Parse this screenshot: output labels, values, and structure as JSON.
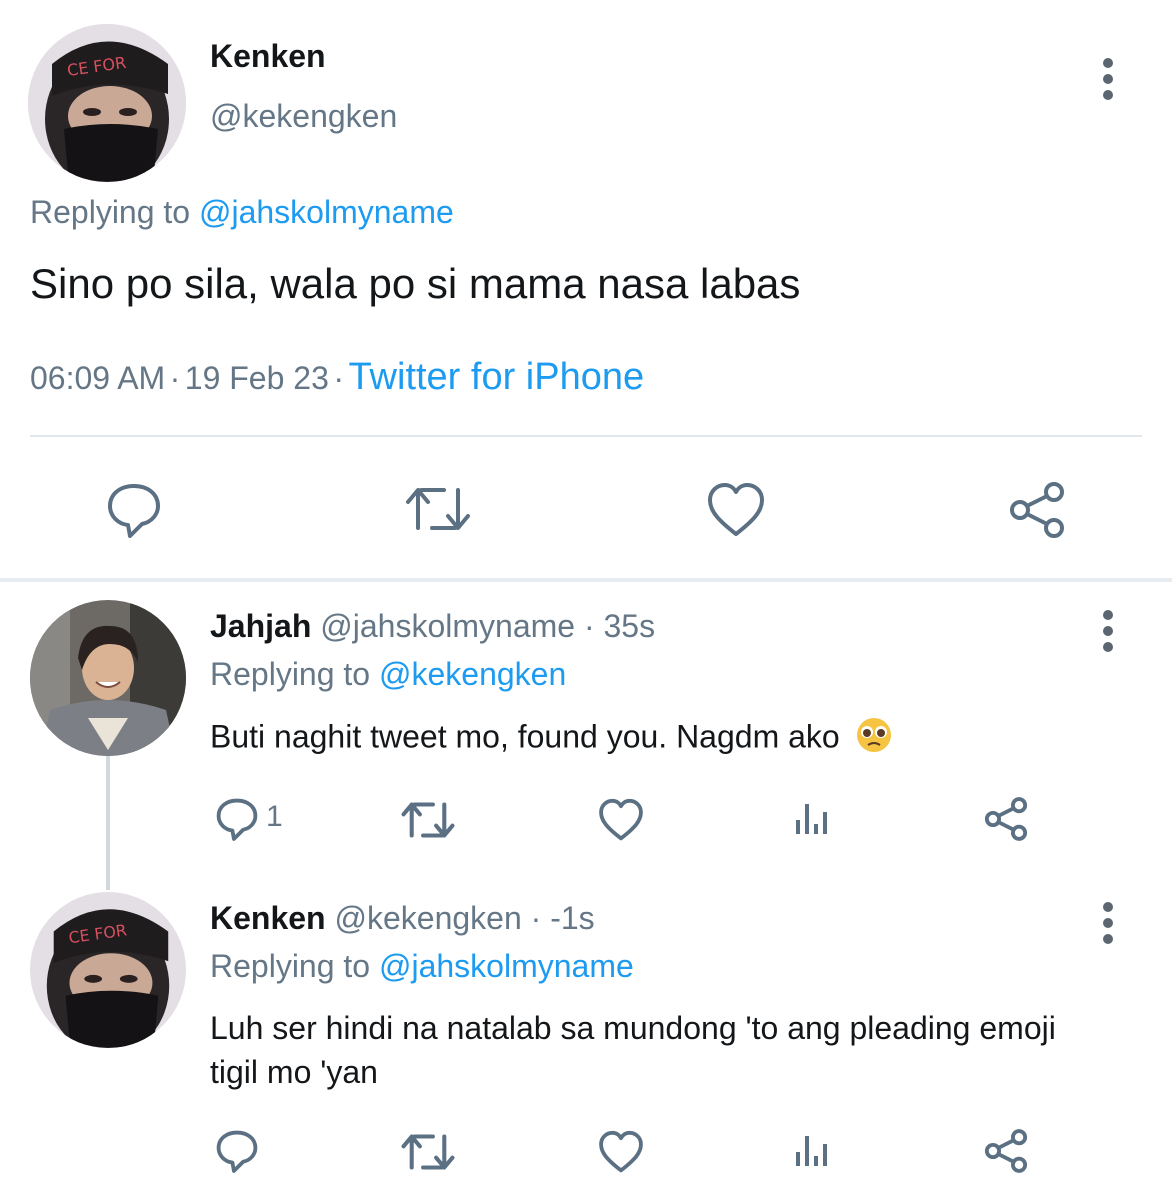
{
  "main_tweet": {
    "author_name": "Kenken",
    "author_handle": "@kekengken",
    "replying_prefix": "Replying to",
    "replying_to": "@jahskolmyname",
    "text": "Sino po sila, wala po si mama nasa labas",
    "time": "06:09 AM",
    "sep1": "·",
    "date": "19 Feb 23",
    "sep2": "·",
    "source": "Twitter for iPhone",
    "actions": [
      "reply-icon",
      "retweet-icon",
      "like-icon",
      "share-icon"
    ]
  },
  "replies": [
    {
      "author_name": "Jahjah",
      "author_handle": "@jahskolmyname",
      "time_suffix": "· 35s",
      "replying_prefix": "Replying to",
      "replying_to": "@kekengken",
      "text": "Buti naghit tweet mo, found you. Nagdm ako",
      "emoji": "pleading-face-emoji",
      "reply_count": "1",
      "actions": [
        "reply-icon",
        "retweet-icon",
        "like-icon",
        "analytics-icon",
        "share-icon"
      ]
    },
    {
      "author_name": "Kenken",
      "author_handle": "@kekengken",
      "time_suffix": "· -1s",
      "replying_prefix": "Replying to",
      "replying_to": "@jahskolmyname",
      "text": "Luh ser hindi na natalab sa mundong 'to ang pleading emoji tigil mo 'yan",
      "actions": [
        "reply-icon",
        "retweet-icon",
        "like-icon",
        "analytics-icon",
        "share-icon"
      ]
    }
  ],
  "colors": {
    "accent": "#1d9bf0",
    "secondary_text": "#657786",
    "icon": "#5b7083",
    "divider": "#e1e8ed"
  }
}
